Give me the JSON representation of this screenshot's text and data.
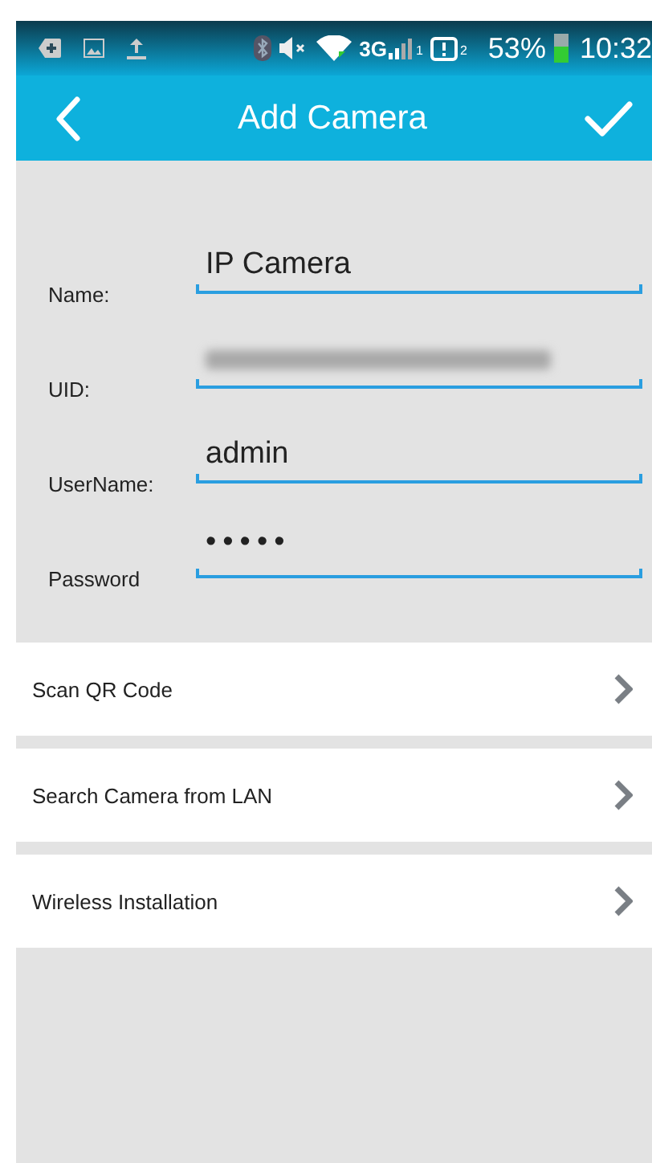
{
  "status_bar": {
    "network": "3G",
    "sim_1": "1",
    "sim_2": "2",
    "battery": "53%",
    "time": "10:32"
  },
  "header": {
    "title": "Add Camera"
  },
  "form": [
    {
      "label": "Name:",
      "value": "IP Camera",
      "kind": "text"
    },
    {
      "label": "UID:",
      "kind": "blurred"
    },
    {
      "label": "UserName:",
      "value": "admin",
      "kind": "text"
    },
    {
      "label": "Password",
      "value": "•••••",
      "kind": "password"
    }
  ],
  "menu": [
    {
      "label": "Scan QR Code"
    },
    {
      "label": "Search Camera from LAN"
    },
    {
      "label": "Wireless Installation"
    }
  ]
}
